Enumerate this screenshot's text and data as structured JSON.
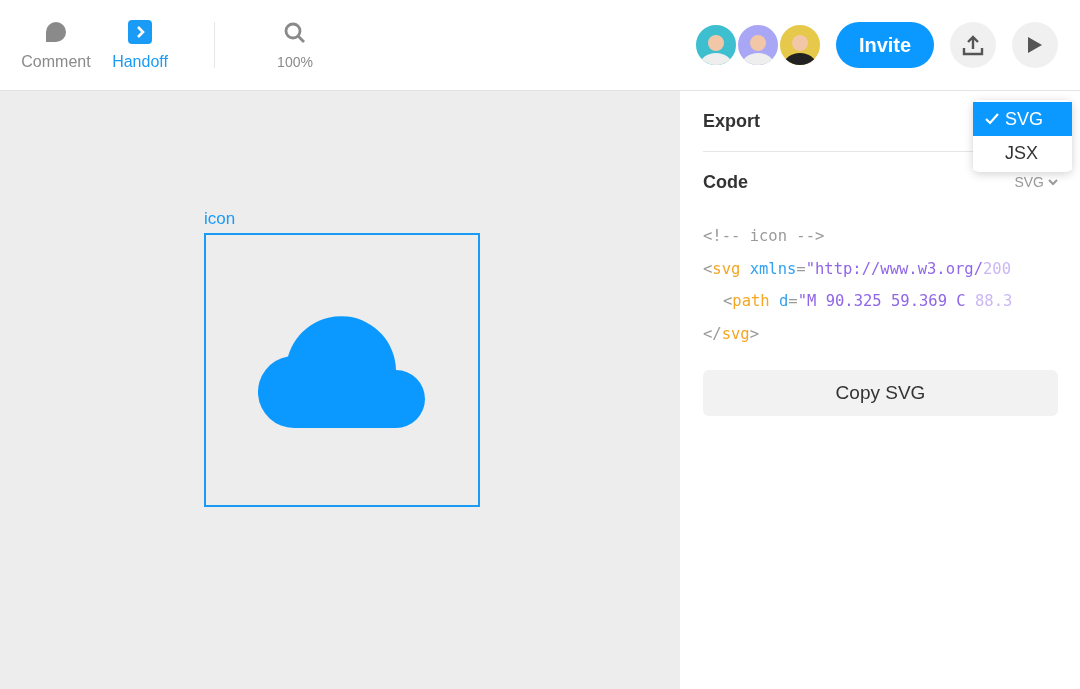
{
  "toolbar": {
    "tools": [
      {
        "kind": "comment",
        "label": "Comment",
        "selected": false
      },
      {
        "kind": "handoff",
        "label": "Handoff",
        "selected": true
      }
    ],
    "zoom": "100%",
    "avatars": [
      {
        "color": "#3dbfcf"
      },
      {
        "color": "#a9a6f5"
      },
      {
        "color": "#e6c84a"
      }
    ],
    "invite": "Invite"
  },
  "canvas": {
    "frame_label": "icon"
  },
  "panel": {
    "export": "Export",
    "code": "Code",
    "format": "SVG",
    "dropdown": [
      {
        "label": "SVG",
        "selected": true
      },
      {
        "label": "JSX",
        "selected": false
      }
    ],
    "code_lines": [
      {
        "indent": false,
        "tokens": [
          {
            "kind": "comment",
            "text": "<!-- icon -->"
          }
        ]
      },
      {
        "indent": false,
        "tokens": [
          {
            "kind": "punct",
            "text": "<"
          },
          {
            "kind": "tag",
            "text": "svg"
          },
          {
            "kind": "attr",
            "text": "xmlns"
          },
          {
            "kind": "punct",
            "text": "="
          },
          {
            "kind": "string",
            "text": "\"http://www.w3.org/"
          },
          {
            "kind": "faded",
            "text": "200"
          }
        ]
      },
      {
        "indent": true,
        "tokens": [
          {
            "kind": "punct",
            "text": "<"
          },
          {
            "kind": "tag",
            "text": "path"
          },
          {
            "kind": "attr",
            "text": "d"
          },
          {
            "kind": "punct",
            "text": "="
          },
          {
            "kind": "string",
            "text": "\"M 90.325 59.369 C "
          },
          {
            "kind": "faded",
            "text": "88.3"
          }
        ]
      },
      {
        "indent": false,
        "tokens": [
          {
            "kind": "punct",
            "text": "</"
          },
          {
            "kind": "tag",
            "text": "svg"
          },
          {
            "kind": "punct",
            "text": ">"
          }
        ]
      }
    ],
    "copy_button": "Copy SVG"
  }
}
